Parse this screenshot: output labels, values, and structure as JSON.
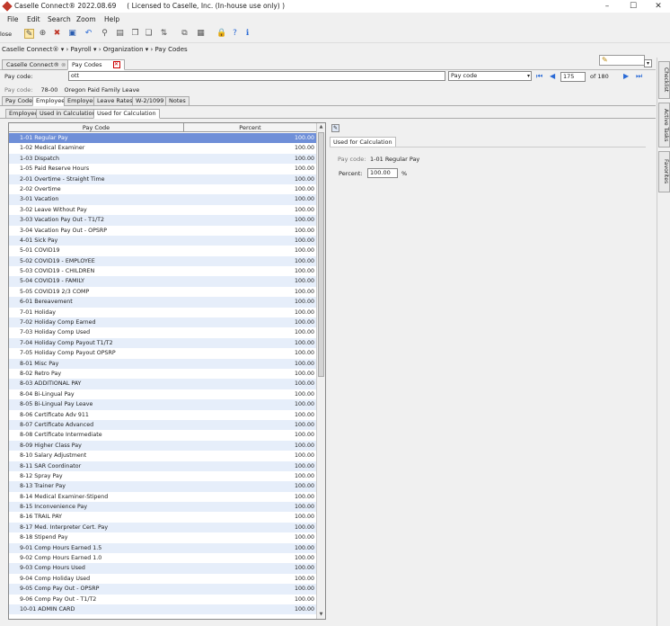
{
  "titlebar": {
    "title": "Caselle Connect® 2022.08.69     ( Licensed to Caselle, Inc. (In-house use only) )"
  },
  "menu": [
    "File",
    "Edit",
    "Search",
    "Zoom",
    "Help"
  ],
  "toolbar": {
    "close_label": "lose"
  },
  "breadcrumb": [
    "Caselle Connect®",
    "Payroll",
    "Organization",
    "Pay Codes"
  ],
  "doc_tabs": [
    "Caselle Connect®",
    "Pay Codes"
  ],
  "search": {
    "label": "Pay code:",
    "value": "ott",
    "field": "Pay code",
    "record": "175",
    "of_total": "of 180"
  },
  "current": {
    "label": "Pay code:",
    "code": "78-00",
    "description": "Oregon Paid Family Leave"
  },
  "subtabs": [
    "Pay Code",
    "Employee",
    "Employer",
    "Leave Rates",
    "W-2/1099",
    "Notes"
  ],
  "active_subtab": "Employee",
  "subtabs2": [
    "Employee",
    "Used in Calculations",
    "Used for Calculation"
  ],
  "active_subtab2": "Used for Calculation",
  "grid": {
    "headers": [
      "Pay Code",
      "Percent"
    ],
    "rows": [
      [
        "1-01 Regular Pay",
        "100.00"
      ],
      [
        "1-02 Medical Examiner",
        "100.00"
      ],
      [
        "1-03 Dispatch",
        "100.00"
      ],
      [
        "1-05 Paid Reserve Hours",
        "100.00"
      ],
      [
        "2-01 Overtime - Straight Time",
        "100.00"
      ],
      [
        "2-02 Overtime",
        "100.00"
      ],
      [
        "3-01 Vacation",
        "100.00"
      ],
      [
        "3-02 Leave Without Pay",
        "100.00"
      ],
      [
        "3-03 Vacation Pay Out - T1/T2",
        "100.00"
      ],
      [
        "3-04 Vacation Pay Out - OPSRP",
        "100.00"
      ],
      [
        "4-01 Sick Pay",
        "100.00"
      ],
      [
        "5-01 COVID19",
        "100.00"
      ],
      [
        "5-02 COVID19 - EMPLOYEE",
        "100.00"
      ],
      [
        "5-03 COVID19 - CHILDREN",
        "100.00"
      ],
      [
        "5-04 COVID19 - FAMILY",
        "100.00"
      ],
      [
        "5-05 COVID19 2/3 COMP",
        "100.00"
      ],
      [
        "6-01 Bereavement",
        "100.00"
      ],
      [
        "7-01 Holiday",
        "100.00"
      ],
      [
        "7-02 Holiday Comp Earned",
        "100.00"
      ],
      [
        "7-03 Holiday Comp Used",
        "100.00"
      ],
      [
        "7-04 Holiday Comp Payout T1/T2",
        "100.00"
      ],
      [
        "7-05 Holiday Comp Payout OPSRP",
        "100.00"
      ],
      [
        "8-01 Misc Pay",
        "100.00"
      ],
      [
        "8-02 Retro Pay",
        "100.00"
      ],
      [
        "8-03 ADDITIONAL PAY",
        "100.00"
      ],
      [
        "8-04 Bi-Lingual Pay",
        "100.00"
      ],
      [
        "8-05 Bi-Lingual Pay Leave",
        "100.00"
      ],
      [
        "8-06 Certificate Adv 911",
        "100.00"
      ],
      [
        "8-07 Certificate Advanced",
        "100.00"
      ],
      [
        "8-08 Certificate Intermediate",
        "100.00"
      ],
      [
        "8-09 Higher Class Pay",
        "100.00"
      ],
      [
        "8-10 Salary Adjustment",
        "100.00"
      ],
      [
        "8-11 SAR Coordinator",
        "100.00"
      ],
      [
        "8-12 Spray Pay",
        "100.00"
      ],
      [
        "8-13 Trainer Pay",
        "100.00"
      ],
      [
        "8-14 Medical Examiner-Stipend",
        "100.00"
      ],
      [
        "8-15 Inconvenience Pay",
        "100.00"
      ],
      [
        "8-16 TRAIL PAY",
        "100.00"
      ],
      [
        "8-17 Med. Interpreter Cert. Pay",
        "100.00"
      ],
      [
        "8-18 Stipend Pay",
        "100.00"
      ],
      [
        "9-01 Comp Hours Earned 1.5",
        "100.00"
      ],
      [
        "9-02 Comp Hours Earned 1.0",
        "100.00"
      ],
      [
        "9-03 Comp Hours Used",
        "100.00"
      ],
      [
        "9-04 Comp Holiday Used",
        "100.00"
      ],
      [
        "9-05 Comp Pay Out - OPSRP",
        "100.00"
      ],
      [
        "9-06 Comp Pay Out - T1/T2",
        "100.00"
      ],
      [
        "10-01 ADMIN CARD",
        "100.00"
      ]
    ]
  },
  "detail": {
    "tab": "Used for Calculation",
    "paycode_label": "Pay code:",
    "paycode_value": "1-01 Regular Pay",
    "percent_label": "Percent:",
    "percent_value": "100.00",
    "percent_sign": "%"
  },
  "sidebar": [
    "Checklist",
    "Active Tasks",
    "Favorites"
  ]
}
